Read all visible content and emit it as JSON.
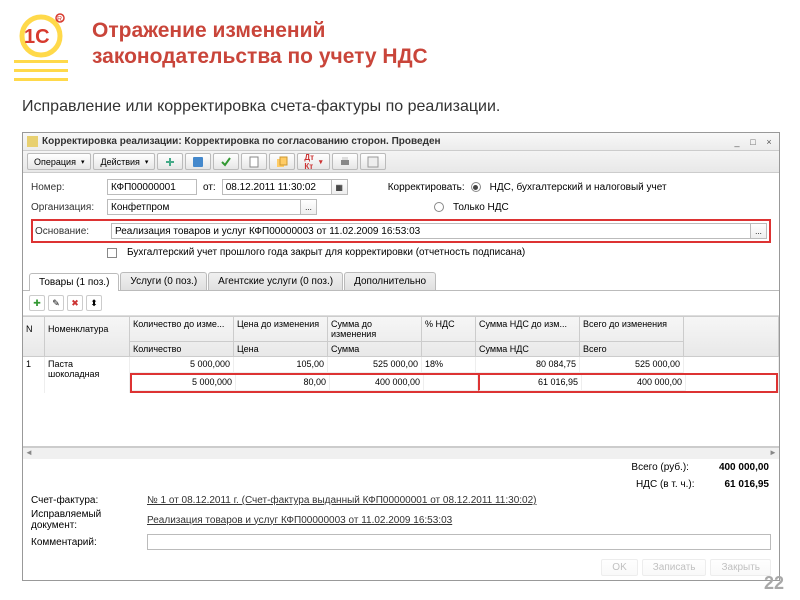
{
  "slide": {
    "title_l1": "Отражение изменений",
    "title_l2": "законодательства по учету НДС",
    "subtitle": "Исправление или корректировка счета-фактуры по реализации.",
    "page": "22"
  },
  "window": {
    "title": "Корректировка реализации: Корректировка по согласованию сторон. Проведен"
  },
  "toolbar": {
    "operation": "Операция",
    "actions": "Действия"
  },
  "form": {
    "number_lbl": "Номер:",
    "number": "КФП00000001",
    "ot": "от:",
    "date": "08.12.2011 11:30:02",
    "org_lbl": "Организация:",
    "org": "Конфетпром",
    "correct_lbl": "Корректировать:",
    "opt1": "НДС, бухгалтерский и налоговый учет",
    "opt2": "Только НДС",
    "basis_lbl": "Основание:",
    "basis": "Реализация товаров и услуг КФП00000003 от 11.02.2009 16:53:03",
    "closed": "Бухгалтерский учет прошлого года закрыт для корректировки (отчетность подписана)"
  },
  "tabs": {
    "t1": "Товары (1 поз.)",
    "t2": "Услуги (0 поз.)",
    "t3": "Агентские услуги (0 поз.)",
    "t4": "Дополнительно"
  },
  "grid": {
    "h_n": "N",
    "h_nom": "Номенклатура",
    "h_qty_b": "Количество до изме...",
    "h_price_b": "Цена до изменения",
    "h_sum_b": "Сумма до изменения",
    "h_vat": "% НДС",
    "h_vsum_b": "Сумма НДС до изм...",
    "h_tot_b": "Всего до изменения",
    "h_qty": "Количество",
    "h_price": "Цена",
    "h_sum": "Сумма",
    "h_vsum": "Сумма НДС",
    "h_tot": "Всего",
    "rows": [
      {
        "n": "1",
        "nom": "Паста шоколадная",
        "qty_b": "5 000,000",
        "price_b": "105,00",
        "sum_b": "525 000,00",
        "vat": "18%",
        "vsum_b": "80 084,75",
        "tot_b": "525 000,00",
        "qty": "5 000,000",
        "price": "80,00",
        "sum": "400 000,00",
        "vsum": "61 016,95",
        "tot": "400 000,00"
      }
    ]
  },
  "totals": {
    "total_lbl": "Всего (руб.):",
    "total": "400 000,00",
    "vat_lbl": "НДС (в т. ч.):",
    "vat": "61 016,95"
  },
  "footer": {
    "sf_lbl": "Счет-фактура:",
    "sf": "№ 1 от 08.12.2011 г. (Счет-фактура выданный КФП00000001 от 08.12.2011 11:30:02)",
    "corr_lbl": "Исправляемый документ:",
    "corr": "Реализация товаров и услуг КФП00000003 от 11.02.2009 16:53:03",
    "comm_lbl": "Комментарий:"
  },
  "buttons": {
    "ok": "OK",
    "save": "Записать",
    "close": "Закрыть"
  }
}
